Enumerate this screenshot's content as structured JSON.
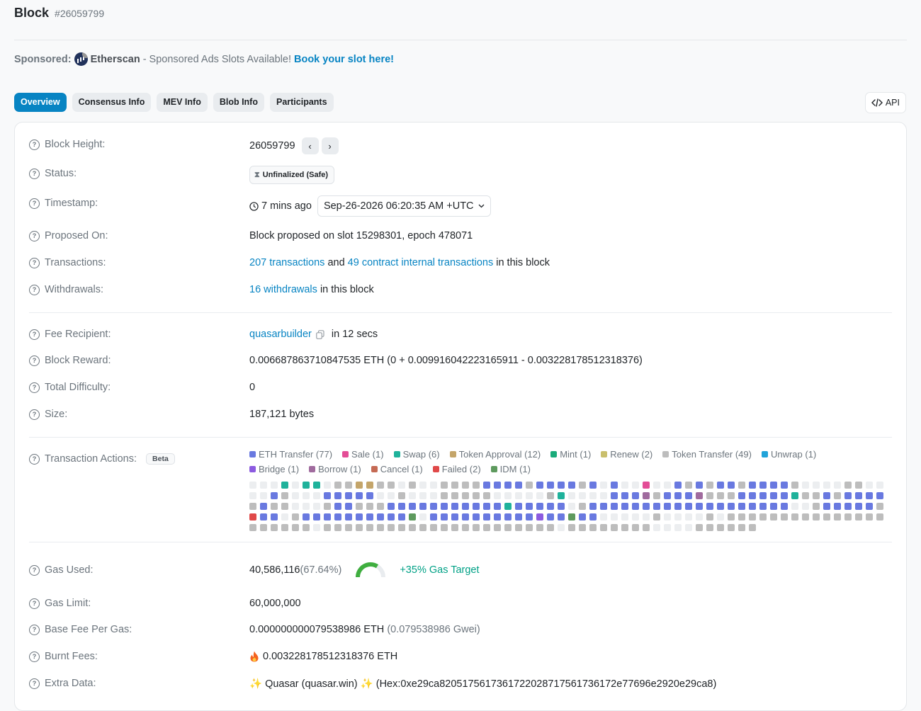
{
  "header": {
    "title": "Block",
    "number": "#26059799"
  },
  "sponsor": {
    "prefix": "Sponsored:",
    "brand": "Etherscan",
    "text": "- Sponsored Ads Slots Available!",
    "cta": "Book your slot here!"
  },
  "tabs": [
    "Overview",
    "Consensus Info",
    "MEV Info",
    "Blob Info",
    "Participants"
  ],
  "api_label": "API",
  "labels": {
    "block_height": "Block Height:",
    "status": "Status:",
    "timestamp": "Timestamp:",
    "proposed_on": "Proposed On:",
    "transactions": "Transactions:",
    "withdrawals": "Withdrawals:",
    "fee_recipient": "Fee Recipient:",
    "block_reward": "Block Reward:",
    "total_difficulty": "Total Difficulty:",
    "size": "Size:",
    "tx_actions": "Transaction Actions:",
    "gas_used": "Gas Used:",
    "gas_limit": "Gas Limit:",
    "base_fee": "Base Fee Per Gas:",
    "burnt_fees": "Burnt Fees:",
    "extra_data": "Extra Data:"
  },
  "block": {
    "height": "26059799",
    "status": "Unfinalized (Safe)",
    "age": "7 mins ago",
    "timestamp": "Sep-26-2026 06:20:35 AM +UTC",
    "proposed": "Block proposed on slot 15298301, epoch 478071",
    "tx_link": "207 transactions",
    "tx_and": "and",
    "tx_internal": "49 contract internal transactions",
    "tx_suffix": "in this block",
    "withdrawals_link": "16 withdrawals",
    "withdrawals_suffix": "in this block",
    "fee_recipient": "quasarbuilder",
    "fee_time": "in 12 secs",
    "reward": "0.006687863710847535 ETH (0 + 0.009916042223165911 - 0.003228178512318376)",
    "difficulty": "0",
    "size": "187,121 bytes",
    "beta": "Beta",
    "gas_used": "40,586,116",
    "gas_used_pct": "(67.64%)",
    "gas_used_fraction": 0.6764,
    "gas_target": "+35% Gas Target",
    "gas_limit": "60,000,000",
    "base_fee": "0.000000000079538986 ETH",
    "base_fee_gwei": "(0.079538986 Gwei)",
    "burnt": "0.003228178512318376 ETH",
    "extra": "✨ Quasar (quasar.win) ✨ (Hex:0xe29ca8205175617361722028717561736172e77696e2920e29ca8)"
  },
  "actions_legend": [
    {
      "label": "ETH Transfer (77)",
      "color": "#6979e0"
    },
    {
      "label": "Sale (1)",
      "color": "#e34d96"
    },
    {
      "label": "Swap (6)",
      "color": "#1fb29b"
    },
    {
      "label": "Token Approval (12)",
      "color": "#c4a56a"
    },
    {
      "label": "Mint (1)",
      "color": "#1aab7a"
    },
    {
      "label": "Renew (2)",
      "color": "#c9bf6d"
    },
    {
      "label": "Token Transfer (49)",
      "color": "#bdbdbd"
    },
    {
      "label": "Unwrap (1)",
      "color": "#20a3d9"
    },
    {
      "label": "Bridge (1)",
      "color": "#8c5be0"
    },
    {
      "label": "Borrow (1)",
      "color": "#a06b9e"
    },
    {
      "label": "Cancel (1)",
      "color": "#c56a54"
    },
    {
      "label": "Failed (2)",
      "color": "#e04949"
    },
    {
      "label": "IDM (1)",
      "color": "#5e9a5e"
    }
  ],
  "action_cells": "EEEWEWWEGGTTGGEGEEGGGGBBBBGBBBBGBEBEEHEEBGBGBBGBBBBGEEEEGGEEEEBGEEEBBBBBEEGEEEGGGGGEEEEEGWEEEEBBBAGBBBAGGGBBBBBWGGBGBBBBGBGGEEEGBBGGGBBBBBBBBBBBWBBBBBEGBBBBBBBBBBBBBBBBBBBEEGBBBBBGRBBEGBBBBBBBBBBFEBBBBBBBBBBXBBIBBEEEEEGEEEEGEGGGGGGGGGGGGGGGGGGGGGEGGGGGGGGGGGGGGGGGGGGGGEGGGGGGGGEEEEGGGGGG",
  "cell_colors": {
    "E": "#eceef0",
    "G": "#bdbdbd",
    "B": "#6979e0",
    "W": "#1fb29b",
    "T": "#c4a56a",
    "M": "#1aab7a",
    "R": "#e04949",
    "A": "#a06b9e",
    "C": "#c56a54",
    "U": "#20a3d9",
    "X": "#8c5be0",
    "N": "#c9bf6d",
    "H": "#e34d96",
    "F": "#5e9a5e",
    "I": "#5e9a5e"
  },
  "accent": "#0784c3"
}
